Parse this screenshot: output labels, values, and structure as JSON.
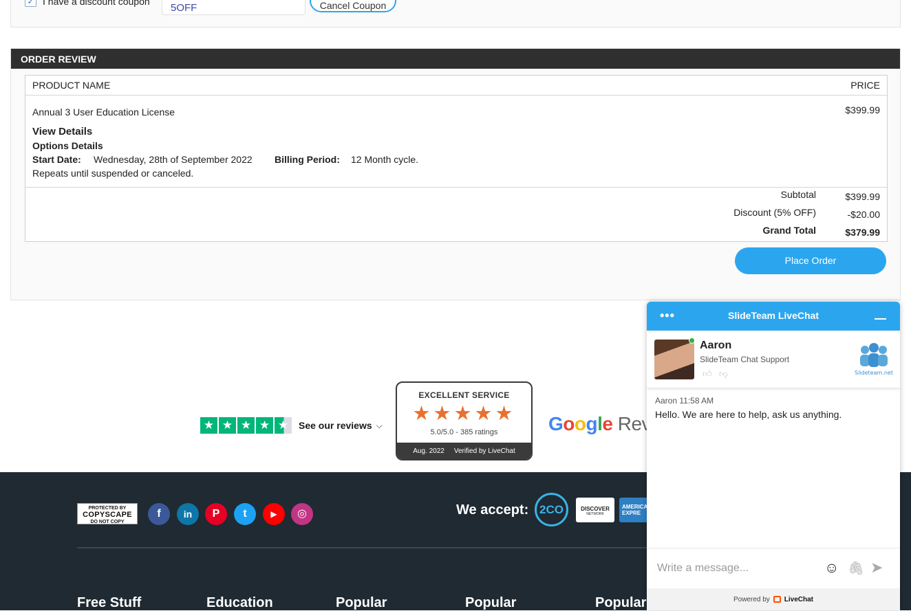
{
  "coupon": {
    "checkbox_label": "I have a discount coupon",
    "checked": true,
    "code": "5OFF",
    "cancel_label": "Cancel Coupon"
  },
  "order_review": {
    "header": "ORDER REVIEW",
    "col_product": "PRODUCT NAME",
    "col_price": "PRICE",
    "item": {
      "name": "Annual 3 User Education License",
      "price": "$399.99",
      "view_details": "View Details",
      "options_details": "Options Details",
      "start_date_label": "Start Date:",
      "start_date": "Wednesday, 28th of September 2022",
      "billing_period_label": "Billing Period:",
      "billing_period": "12 Month cycle.",
      "repeat_note": "Repeats until suspended or canceled."
    },
    "totals": {
      "subtotal_label": "Subtotal",
      "subtotal": "$399.99",
      "discount_label": "Discount (5% OFF)",
      "discount": "-$20.00",
      "grand_total_label": "Grand Total",
      "grand_total": "$379.99"
    },
    "place_order": "Place Order"
  },
  "reviews": {
    "trustpilot_text": "See our reviews",
    "livechat_badge": {
      "title": "EXCELLENT SERVICE",
      "stars": "★★★★★",
      "rating": "5.0/5.0 - 385 ratings",
      "date": "Aug. 2022",
      "verified": "Verified by LiveChat"
    },
    "google_word": [
      "G",
      "o",
      "o",
      "g",
      "l",
      "e"
    ],
    "google_suffix": "Revie"
  },
  "footer": {
    "copyscape_top": "PROTECTED BY",
    "copyscape_main": "COPYSCAPE",
    "copyscape_bottom": "DO NOT COPY",
    "social": [
      {
        "name": "facebook",
        "glyph": "f",
        "color": "#3b5998"
      },
      {
        "name": "linkedin",
        "glyph": "in",
        "color": "#0e76a8"
      },
      {
        "name": "pinterest",
        "glyph": "P",
        "color": "#e60023"
      },
      {
        "name": "twitter",
        "glyph": "t",
        "color": "#1da1f2"
      },
      {
        "name": "youtube",
        "glyph": "▶",
        "color": "#ff0000"
      },
      {
        "name": "instagram",
        "glyph": "◎",
        "color": "#c13584"
      }
    ],
    "we_accept": "We accept:",
    "pay_2co": "2CO",
    "pay_discover": "DISCOVER",
    "pay_discover_sub": "NETWORK",
    "pay_amex": "AMERICAN EXPRE",
    "columns": [
      "Free Stuff",
      "Education",
      "Popular",
      "Popular",
      "Popular"
    ]
  },
  "chat": {
    "title": "SlideTeam LiveChat",
    "agent_name": "Aaron",
    "agent_role": "SlideTeam Chat Support",
    "brand_text": "Slideteam.net",
    "message_meta": "Aaron 11:58 AM",
    "message": "Hello. We are here to help, ask us anything.",
    "input_placeholder": "Write a message...",
    "powered_by": "Powered by",
    "powered_brand": "LiveChat"
  },
  "colors": {
    "accent": "#2ba6ee",
    "header_dark": "#2f2f2f",
    "footer_bg": "#1f2a33",
    "trustpilot_green": "#00b67a",
    "star_orange": "#e8712f"
  }
}
